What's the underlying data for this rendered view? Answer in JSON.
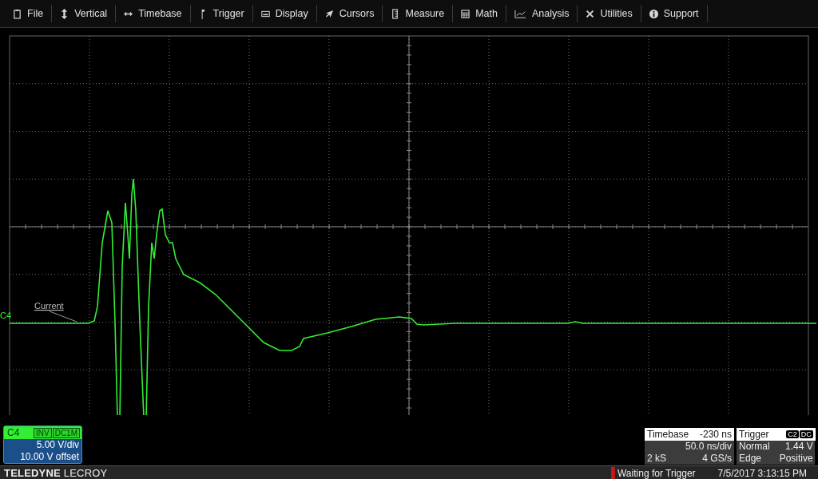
{
  "menu": [
    {
      "label": "File"
    },
    {
      "label": "Vertical"
    },
    {
      "label": "Timebase"
    },
    {
      "label": "Trigger"
    },
    {
      "label": "Display"
    },
    {
      "label": "Cursors"
    },
    {
      "label": "Measure"
    },
    {
      "label": "Math"
    },
    {
      "label": "Analysis"
    },
    {
      "label": "Utilities"
    },
    {
      "label": "Support"
    }
  ],
  "graticule": {
    "trace_marker": "C4",
    "trace_label": "Current"
  },
  "channel": {
    "name": "C4",
    "tags": [
      "INV",
      "DC1M"
    ],
    "scale": "5.00 V/div",
    "offset": "10.00 V offset"
  },
  "timebase": {
    "title": "Timebase",
    "delay": "-230 ns",
    "scale": "50.0 ns/div",
    "samples": "2 kS",
    "rate": "4 GS/s"
  },
  "trigger": {
    "title": "Trigger",
    "tags": [
      "C2",
      "DC"
    ],
    "mode": "Normal",
    "level": "1.44 V",
    "type": "Edge",
    "slope": "Positive"
  },
  "footer": {
    "logo": "**TELEDYNE** LECROY",
    "status": "Waiting for Trigger",
    "datetime": "7/5/2017 3:13:15 PM"
  }
}
